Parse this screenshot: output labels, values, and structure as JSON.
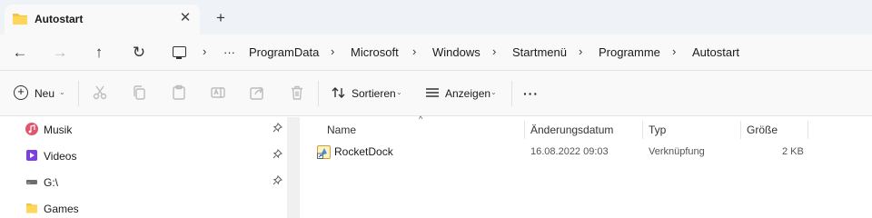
{
  "tab": {
    "title": "Autostart",
    "close_glyph": "✕",
    "new_tab_glyph": "+"
  },
  "navigation": {
    "back_glyph": "←",
    "forward_glyph": "→",
    "up_glyph": "↑",
    "refresh_glyph": "↻"
  },
  "breadcrumb": {
    "overflow": "···",
    "separator": "›",
    "items": [
      "ProgramData",
      "Microsoft",
      "Windows",
      "Startmenü",
      "Programme",
      "Autostart"
    ]
  },
  "toolbar": {
    "new_label": "Neu",
    "sort_label": "Sortieren",
    "view_label": "Anzeigen",
    "more_glyph": "···",
    "chevron": "⌄"
  },
  "sidebar": {
    "pin_glyph": "📌",
    "items": [
      {
        "label": "Musik",
        "icon": "music-icon",
        "pinned": true
      },
      {
        "label": "Videos",
        "icon": "video-icon",
        "pinned": true
      },
      {
        "label": "G:\\",
        "icon": "drive-icon",
        "pinned": true
      },
      {
        "label": "Games",
        "icon": "folder-icon",
        "pinned": false
      }
    ]
  },
  "file_list": {
    "sort_caret": "^",
    "columns": [
      "Name",
      "Änderungsdatum",
      "Typ",
      "Größe"
    ],
    "rows": [
      {
        "name": "RocketDock",
        "modified": "16.08.2022 09:03",
        "type": "Verknüpfung",
        "size": "2 KB",
        "icon": "shortcut-icon"
      }
    ]
  },
  "colors": {
    "folder": "#f4c542",
    "accent": "#0067c0",
    "music": "#e0566d",
    "video": "#7b3fe4"
  }
}
